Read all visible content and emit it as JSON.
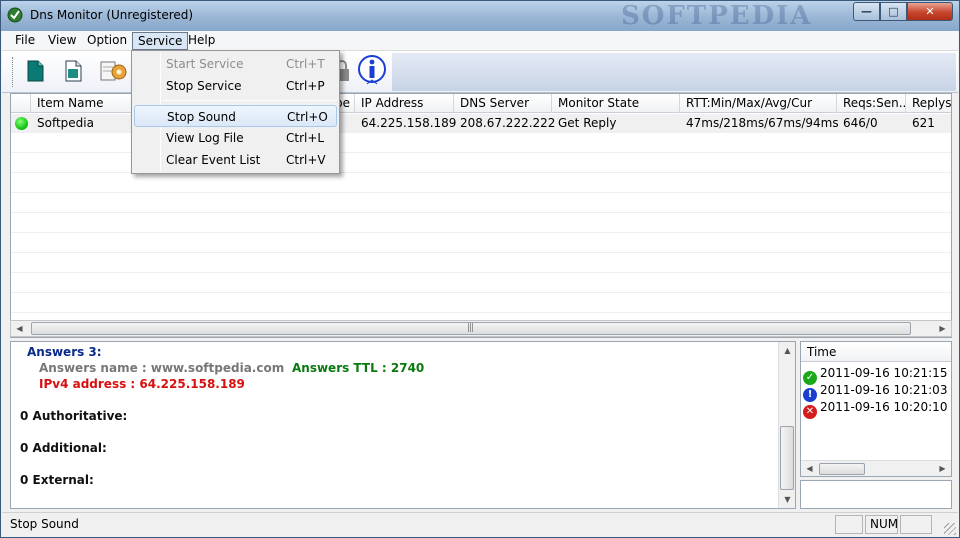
{
  "window": {
    "title": "Dns Monitor (Unregistered)",
    "watermark": "SOFTPEDIA",
    "controls": {
      "minimize": "—",
      "maximize": "□",
      "close": "✕"
    }
  },
  "menubar": {
    "items": [
      {
        "label": "File"
      },
      {
        "label": "View"
      },
      {
        "label": "Option"
      },
      {
        "label": "Service"
      },
      {
        "label": "Help"
      }
    ]
  },
  "toolbar": {
    "icons": [
      "new-item-icon",
      "document-icon",
      "options-icon",
      "info-icon"
    ]
  },
  "service_menu": {
    "items": [
      {
        "label": "Start Service",
        "shortcut": "Ctrl+T",
        "state": "disabled"
      },
      {
        "label": "Stop Service",
        "shortcut": "Ctrl+P",
        "state": "normal"
      },
      {
        "label": "Stop Sound",
        "shortcut": "Ctrl+O",
        "state": "highlighted"
      },
      {
        "label": "View Log File",
        "shortcut": "Ctrl+L",
        "state": "normal"
      },
      {
        "label": "Clear Event List",
        "shortcut": "Ctrl+V",
        "state": "normal"
      }
    ]
  },
  "list": {
    "columns": [
      "Item Name",
      "pe",
      "IP Address",
      "DNS Server",
      "Monitor State",
      "RTT:Min/Max/Avg/Cur",
      "Reqs:Sen...",
      "Replys"
    ],
    "rows": [
      {
        "status": "online",
        "name": "Softpedia",
        "ip": "64.225.158.189",
        "dns": "208.67.222.222",
        "state": "Get Reply",
        "rtt": "47ms/218ms/67ms/94ms",
        "reqs": "646/0",
        "replys": "621"
      }
    ]
  },
  "details": {
    "answers_header": "Answers 3:",
    "answers_name": "Answers name : www.softpedia.com",
    "answers_ttl": "Answers TTL : 2740",
    "ipv4": "IPv4 address :  64.225.158.189",
    "authoritative": "0 Authoritative:",
    "additional": "0 Additional:",
    "external": "0 External:"
  },
  "events": {
    "header": "Time",
    "items": [
      {
        "type": "success",
        "time": "2011-09-16 10:21:15"
      },
      {
        "type": "info",
        "time": "2011-09-16 10:21:03"
      },
      {
        "type": "error",
        "time": "2011-09-16 10:20:10"
      }
    ]
  },
  "statusbar": {
    "message": "Stop Sound",
    "num": "NUM"
  },
  "colors": {
    "online": "#14c814",
    "highlight_text_navy": "#0a2a8a",
    "ipv4_red": "#d81010",
    "ttl_green": "#0a7a10"
  }
}
